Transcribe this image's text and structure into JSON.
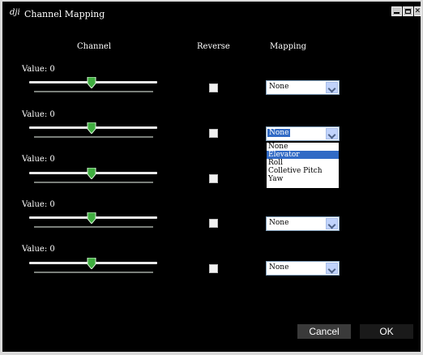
{
  "window": {
    "title": "Channel Mapping",
    "icon": "dji-logo-icon"
  },
  "headers": {
    "channel": "Channel",
    "reverse": "Reverse",
    "mapping": "Mapping"
  },
  "channels": [
    {
      "value_label": "Value: 0",
      "slider_position": 0.5,
      "reverse": false,
      "mapping": "None"
    },
    {
      "value_label": "Value: 0",
      "slider_position": 0.5,
      "reverse": false,
      "mapping": "None"
    },
    {
      "value_label": "Value: 0",
      "slider_position": 0.5,
      "reverse": false,
      "mapping": ""
    },
    {
      "value_label": "Value: 0",
      "slider_position": 0.5,
      "reverse": false,
      "mapping": "None"
    },
    {
      "value_label": "Value: 0",
      "slider_position": 0.5,
      "reverse": false,
      "mapping": "None"
    }
  ],
  "dropdown_open": {
    "options": [
      "None",
      "Elevator",
      "Roll",
      "Colletive Pitch",
      "Yaw"
    ],
    "highlighted": "Elevator"
  },
  "buttons": {
    "cancel": "Cancel",
    "ok": "OK"
  },
  "colors": {
    "background": "#000000",
    "highlight": "#316ac5",
    "knob": "#3fae3f"
  }
}
